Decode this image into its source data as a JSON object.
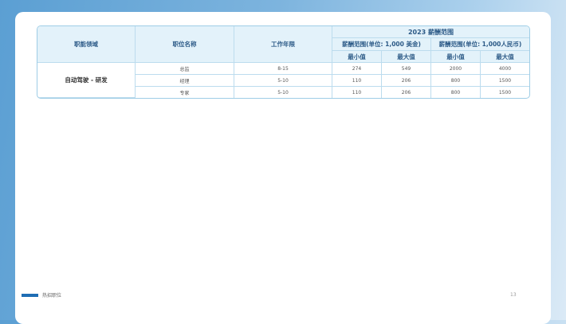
{
  "table": {
    "headers": {
      "area": "职能领域",
      "position": "职位名称",
      "years": "工作年限",
      "year_range": "2023 薪酬范围",
      "usd_range": "薪酬范围(单位: 1,000 美金)",
      "rmb_range": "薪酬范围(单位: 1,000人民币)",
      "min": "最小值",
      "max": "最大值"
    },
    "area": "自动驾驶 - 研发",
    "rows": [
      {
        "position": "总监",
        "years": "8-15",
        "usd_min": "274",
        "usd_max": "549",
        "rmb_min": "2000",
        "rmb_max": "4000"
      },
      {
        "position": "经理",
        "years": "5-10",
        "usd_min": "110",
        "usd_max": "206",
        "rmb_min": "800",
        "rmb_max": "1500"
      },
      {
        "position": "专家",
        "years": "5-10",
        "usd_min": "110",
        "usd_max": "206",
        "rmb_min": "800",
        "rmb_max": "1500"
      }
    ]
  },
  "footer": {
    "section_label": "热招职位",
    "page_number": "13",
    "accent_color": "#1f6db4"
  }
}
